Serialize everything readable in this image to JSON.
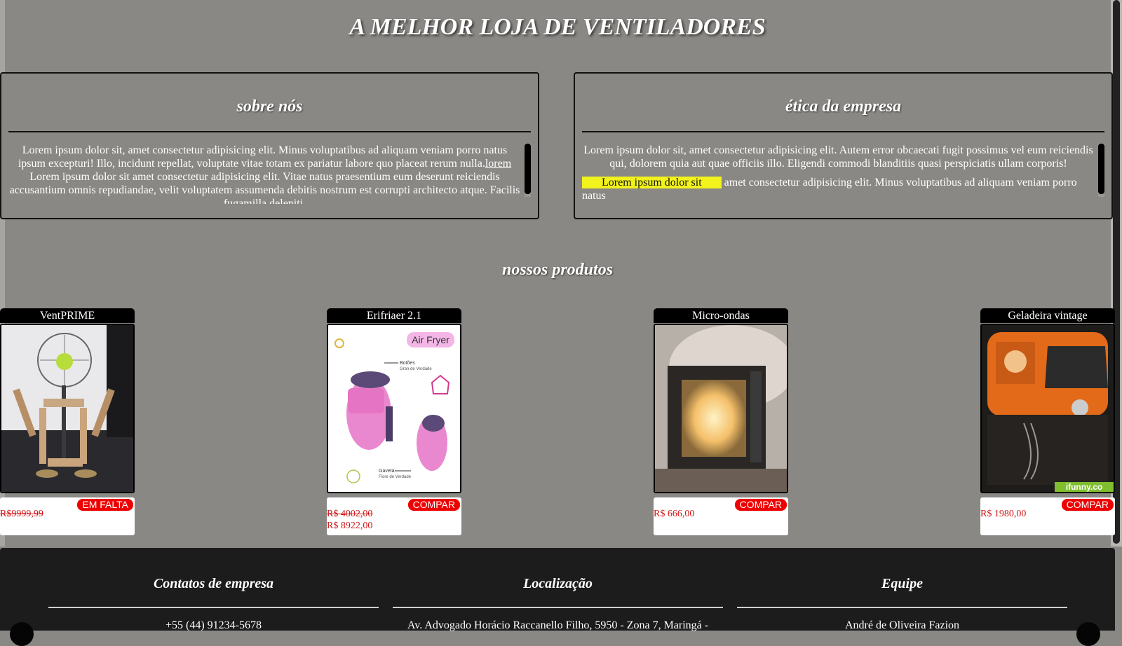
{
  "site": {
    "title": "A MELHOR LOJA DE VENTILADORES"
  },
  "about": {
    "title": "sobre nós",
    "p1_a": "Lorem ipsum dolor sit, amet consectetur adipisicing elit. Minus voluptatibus ad aliquam veniam porro natus ipsum excepturi! Illo, incidunt repellat, voluptate vitae totam ex pariatur labore quo placeat rerum nulla.",
    "p1_link": "lorem",
    "p1_b": " Lorem ipsum dolor sit amet consectetur adipisicing elit. Vitae natus praesentium eum deserunt reiciendis accusantium omnis repudiandae, velit voluptatem assumenda debitis nostrum est corrupti architecto atque. Facilis fugamilla deleniti."
  },
  "ethics": {
    "title": "ética da empresa",
    "p1": "Lorem ipsum dolor sit, amet consectetur adipisicing elit. Autem error obcaecati fugit possimus vel eum reiciendis qui, dolorem quia aut quae officiis illo. Eligendi commodi blanditiis quasi perspiciatis ullam corporis!",
    "p2_highlight": "Lorem ipsum dolor sit",
    "p2": " amet consectetur adipisicing elit. Minus voluptatibus ad aliquam veniam porro natus"
  },
  "products": {
    "title": "nossos produtos",
    "items": [
      {
        "name": "VentPRIME",
        "button": "EM FALTA",
        "old_price": "R$9999,99",
        "new_price": "",
        "price": ""
      },
      {
        "name": "Erifriaer 2.1",
        "button": "COMPAR",
        "old_price": "R$ 4002,00",
        "new_price": "R$ 8922,00",
        "price": ""
      },
      {
        "name": "Micro-ondas",
        "button": "COMPAR",
        "old_price": "",
        "new_price": "",
        "price": "R$ 666,00"
      },
      {
        "name": "Geladeira vintage",
        "button": "COMPAR",
        "old_price": "",
        "new_price": "",
        "price": "R$ 1980,00"
      }
    ],
    "image_text": {
      "airfryer_label": "Air Fryer",
      "airfryer_callout1": "Botões",
      "airfryer_callout1b": "Gran de Verdade",
      "airfryer_callout2": "Gaveta",
      "airfryer_callout2b": "Flore de Verdade",
      "watermark": "ifunny.co"
    }
  },
  "footer": {
    "contacts": {
      "title": "Contatos de empresa",
      "line": "+55 (44) 91234-5678"
    },
    "location": {
      "title": "Localização",
      "line": "Av. Advogado Horácio Raccanello Filho, 5950 - Zona 7, Maringá -"
    },
    "team": {
      "title": "Equipe",
      "line": "André de Oliveira Fazion"
    }
  },
  "colors": {
    "background": "#8a8884",
    "footer": "#1c1c1c",
    "buy_button": "#ee0000",
    "price": "#d01818",
    "highlight": "#f2f21d"
  },
  "icons": [
    "vertical-scrollbar",
    "box-scrollbar"
  ]
}
